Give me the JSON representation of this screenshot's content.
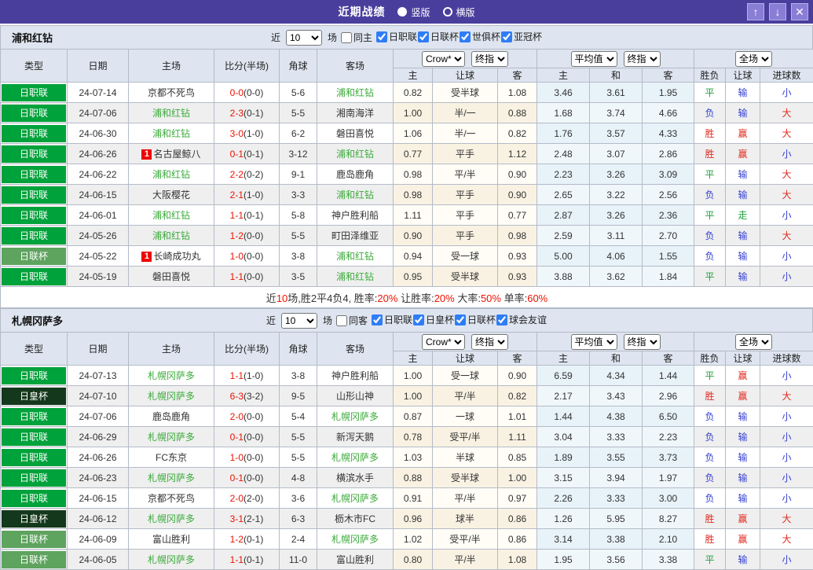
{
  "titlebar": {
    "title": "近期战绩",
    "radios": [
      {
        "label": "竖版",
        "selected": true
      },
      {
        "label": "横版",
        "selected": false
      }
    ],
    "buttons": {
      "up": "↑",
      "down": "↓",
      "close": "✕"
    }
  },
  "colors": {
    "titlebar_bg": "#4a3e9d",
    "button_bg": "#8a7dd5",
    "header_bg": "#dee5f0",
    "league_j1": "#00a23b",
    "league_cup": "#5ea35e",
    "emperor_cup": "#14381b",
    "team_highlight": "#3cab3c",
    "score_red": "#ee1100",
    "win_red": "#e02a1f",
    "draw_green": "#1fa03c",
    "lose_blue": "#3540d0"
  },
  "filter_labels": {
    "near": "近",
    "games": "场"
  },
  "columns": {
    "type": "类型",
    "date": "日期",
    "home": "主场",
    "score": "比分(半场)",
    "corner": "角球",
    "away": "客场",
    "h": "主",
    "handicap": "让球",
    "a": "客",
    "avg_h": "主",
    "avg_d": "和",
    "avg_a": "客",
    "result": "胜负",
    "r_handicap": "让球",
    "goals": "进球数"
  },
  "selects": {
    "crow": "Crow*",
    "final": "终指",
    "average": "平均值",
    "final2": "终指",
    "fulltime": "全场"
  },
  "sections": [
    {
      "team": "浦和红钻",
      "filter": {
        "count": "10",
        "same_label": "同主",
        "same_checked": false,
        "leagues": [
          {
            "label": "日职联",
            "checked": true
          },
          {
            "label": "日联杯",
            "checked": true
          },
          {
            "label": "世俱杯",
            "checked": true
          },
          {
            "label": "亚冠杯",
            "checked": true
          }
        ]
      },
      "rows": [
        {
          "type": "日职联",
          "type_key": "jl",
          "date": "24-07-14",
          "home": "京都不死鸟",
          "home_hl": false,
          "home_rc": false,
          "score": "0-0",
          "half": "(0-0)",
          "corner": "5-6",
          "away": "浦和红钻",
          "away_hl": true,
          "away_rc": false,
          "crow": [
            "0.82",
            "受半球",
            "1.08"
          ],
          "avg": [
            "3.46",
            "3.61",
            "1.95"
          ],
          "results": [
            [
              "平",
              "g"
            ],
            [
              "输",
              "b"
            ],
            [
              "小",
              "b"
            ]
          ]
        },
        {
          "type": "日职联",
          "type_key": "jl",
          "date": "24-07-06",
          "home": "浦和红钻",
          "home_hl": true,
          "home_rc": false,
          "score": "2-3",
          "half": "(0-1)",
          "corner": "5-5",
          "away": "湘南海洋",
          "away_hl": false,
          "away_rc": false,
          "crow": [
            "1.00",
            "半/一",
            "0.88"
          ],
          "avg": [
            "1.68",
            "3.74",
            "4.66"
          ],
          "results": [
            [
              "负",
              "b"
            ],
            [
              "输",
              "b"
            ],
            [
              "大",
              "r"
            ]
          ]
        },
        {
          "type": "日职联",
          "type_key": "jl",
          "date": "24-06-30",
          "home": "浦和红钻",
          "home_hl": true,
          "home_rc": false,
          "score": "3-0",
          "half": "(1-0)",
          "corner": "6-2",
          "away": "磐田喜悦",
          "away_hl": false,
          "away_rc": false,
          "crow": [
            "1.06",
            "半/一",
            "0.82"
          ],
          "avg": [
            "1.76",
            "3.57",
            "4.33"
          ],
          "results": [
            [
              "胜",
              "r"
            ],
            [
              "赢",
              "r"
            ],
            [
              "大",
              "r"
            ]
          ]
        },
        {
          "type": "日职联",
          "type_key": "jl",
          "date": "24-06-26",
          "home": "名古屋鲸八",
          "home_hl": false,
          "home_rc": true,
          "score": "0-1",
          "half": "(0-1)",
          "corner": "3-12",
          "away": "浦和红钻",
          "away_hl": true,
          "away_rc": false,
          "crow": [
            "0.77",
            "平手",
            "1.12"
          ],
          "avg": [
            "2.48",
            "3.07",
            "2.86"
          ],
          "results": [
            [
              "胜",
              "r"
            ],
            [
              "赢",
              "r"
            ],
            [
              "小",
              "b"
            ]
          ]
        },
        {
          "type": "日职联",
          "type_key": "jl",
          "date": "24-06-22",
          "home": "浦和红钻",
          "home_hl": true,
          "home_rc": false,
          "score": "2-2",
          "half": "(0-2)",
          "corner": "9-1",
          "away": "鹿岛鹿角",
          "away_hl": false,
          "away_rc": false,
          "crow": [
            "0.98",
            "平/半",
            "0.90"
          ],
          "avg": [
            "2.23",
            "3.26",
            "3.09"
          ],
          "results": [
            [
              "平",
              "g"
            ],
            [
              "输",
              "b"
            ],
            [
              "大",
              "r"
            ]
          ]
        },
        {
          "type": "日职联",
          "type_key": "jl",
          "date": "24-06-15",
          "home": "大阪樱花",
          "home_hl": false,
          "home_rc": false,
          "score": "2-1",
          "half": "(1-0)",
          "corner": "3-3",
          "away": "浦和红钻",
          "away_hl": true,
          "away_rc": false,
          "crow": [
            "0.98",
            "平手",
            "0.90"
          ],
          "avg": [
            "2.65",
            "3.22",
            "2.56"
          ],
          "results": [
            [
              "负",
              "b"
            ],
            [
              "输",
              "b"
            ],
            [
              "大",
              "r"
            ]
          ]
        },
        {
          "type": "日职联",
          "type_key": "jl",
          "date": "24-06-01",
          "home": "浦和红钻",
          "home_hl": true,
          "home_rc": false,
          "score": "1-1",
          "half": "(0-1)",
          "corner": "5-8",
          "away": "神户胜利船",
          "away_hl": false,
          "away_rc": false,
          "crow": [
            "1.11",
            "平手",
            "0.77"
          ],
          "avg": [
            "2.87",
            "3.26",
            "2.36"
          ],
          "results": [
            [
              "平",
              "g"
            ],
            [
              "走",
              "g"
            ],
            [
              "小",
              "b"
            ]
          ]
        },
        {
          "type": "日职联",
          "type_key": "jl",
          "date": "24-05-26",
          "home": "浦和红钻",
          "home_hl": true,
          "home_rc": false,
          "score": "1-2",
          "half": "(0-0)",
          "corner": "5-5",
          "away": "町田泽维亚",
          "away_hl": false,
          "away_rc": false,
          "crow": [
            "0.90",
            "平手",
            "0.98"
          ],
          "avg": [
            "2.59",
            "3.11",
            "2.70"
          ],
          "results": [
            [
              "负",
              "b"
            ],
            [
              "输",
              "b"
            ],
            [
              "大",
              "r"
            ]
          ]
        },
        {
          "type": "日联杯",
          "type_key": "lc",
          "date": "24-05-22",
          "home": "长崎成功丸",
          "home_hl": false,
          "home_rc": true,
          "score": "1-0",
          "half": "(0-0)",
          "corner": "3-8",
          "away": "浦和红钻",
          "away_hl": true,
          "away_rc": false,
          "crow": [
            "0.94",
            "受一球",
            "0.93"
          ],
          "avg": [
            "5.00",
            "4.06",
            "1.55"
          ],
          "results": [
            [
              "负",
              "b"
            ],
            [
              "输",
              "b"
            ],
            [
              "小",
              "b"
            ]
          ]
        },
        {
          "type": "日职联",
          "type_key": "jl",
          "date": "24-05-19",
          "home": "磐田喜悦",
          "home_hl": false,
          "home_rc": false,
          "score": "1-1",
          "half": "(0-0)",
          "corner": "3-5",
          "away": "浦和红钻",
          "away_hl": true,
          "away_rc": false,
          "crow": [
            "0.95",
            "受半球",
            "0.93"
          ],
          "avg": [
            "3.88",
            "3.62",
            "1.84"
          ],
          "results": [
            [
              "平",
              "g"
            ],
            [
              "输",
              "b"
            ],
            [
              "小",
              "b"
            ]
          ]
        }
      ],
      "summary": [
        [
          "近",
          "k"
        ],
        [
          "10",
          "r"
        ],
        [
          "场,胜2平4负4, 胜率:",
          "k"
        ],
        [
          "20%",
          "r"
        ],
        [
          " 让胜率:",
          "k"
        ],
        [
          "20%",
          "r"
        ],
        [
          " 大率:",
          "k"
        ],
        [
          "50%",
          "r"
        ],
        [
          " 单率:",
          "k"
        ],
        [
          "60%",
          "r"
        ]
      ]
    },
    {
      "team": "札幌冈萨多",
      "filter": {
        "count": "10",
        "same_label": "同客",
        "same_checked": false,
        "leagues": [
          {
            "label": "日职联",
            "checked": true
          },
          {
            "label": "日皇杯",
            "checked": true
          },
          {
            "label": "日联杯",
            "checked": true
          },
          {
            "label": "球会友谊",
            "checked": true
          }
        ]
      },
      "rows": [
        {
          "type": "日职联",
          "type_key": "jl",
          "date": "24-07-13",
          "home": "札幌冈萨多",
          "home_hl": true,
          "home_rc": false,
          "score": "1-1",
          "half": "(1-0)",
          "corner": "3-8",
          "away": "神户胜利船",
          "away_hl": false,
          "away_rc": false,
          "crow": [
            "1.00",
            "受一球",
            "0.90"
          ],
          "avg": [
            "6.59",
            "4.34",
            "1.44"
          ],
          "results": [
            [
              "平",
              "g"
            ],
            [
              "赢",
              "r"
            ],
            [
              "小",
              "b"
            ]
          ]
        },
        {
          "type": "日皇杯",
          "type_key": "ec",
          "date": "24-07-10",
          "home": "札幌冈萨多",
          "home_hl": true,
          "home_rc": false,
          "score": "6-3",
          "half": "(3-2)",
          "corner": "9-5",
          "away": "山形山神",
          "away_hl": false,
          "away_rc": false,
          "crow": [
            "1.00",
            "平/半",
            "0.82"
          ],
          "avg": [
            "2.17",
            "3.43",
            "2.96"
          ],
          "results": [
            [
              "胜",
              "r"
            ],
            [
              "赢",
              "r"
            ],
            [
              "大",
              "r"
            ]
          ]
        },
        {
          "type": "日职联",
          "type_key": "jl",
          "date": "24-07-06",
          "home": "鹿岛鹿角",
          "home_hl": false,
          "home_rc": false,
          "score": "2-0",
          "half": "(0-0)",
          "corner": "5-4",
          "away": "札幌冈萨多",
          "away_hl": true,
          "away_rc": false,
          "crow": [
            "0.87",
            "一球",
            "1.01"
          ],
          "avg": [
            "1.44",
            "4.38",
            "6.50"
          ],
          "results": [
            [
              "负",
              "b"
            ],
            [
              "输",
              "b"
            ],
            [
              "小",
              "b"
            ]
          ]
        },
        {
          "type": "日职联",
          "type_key": "jl",
          "date": "24-06-29",
          "home": "札幌冈萨多",
          "home_hl": true,
          "home_rc": false,
          "score": "0-1",
          "half": "(0-0)",
          "corner": "5-5",
          "away": "新泻天鹅",
          "away_hl": false,
          "away_rc": false,
          "crow": [
            "0.78",
            "受平/半",
            "1.11"
          ],
          "avg": [
            "3.04",
            "3.33",
            "2.23"
          ],
          "results": [
            [
              "负",
              "b"
            ],
            [
              "输",
              "b"
            ],
            [
              "小",
              "b"
            ]
          ]
        },
        {
          "type": "日职联",
          "type_key": "jl",
          "date": "24-06-26",
          "home": "FC东京",
          "home_hl": false,
          "home_rc": false,
          "score": "1-0",
          "half": "(0-0)",
          "corner": "5-5",
          "away": "札幌冈萨多",
          "away_hl": true,
          "away_rc": false,
          "crow": [
            "1.03",
            "半球",
            "0.85"
          ],
          "avg": [
            "1.89",
            "3.55",
            "3.73"
          ],
          "results": [
            [
              "负",
              "b"
            ],
            [
              "输",
              "b"
            ],
            [
              "小",
              "b"
            ]
          ]
        },
        {
          "type": "日职联",
          "type_key": "jl",
          "date": "24-06-23",
          "home": "札幌冈萨多",
          "home_hl": true,
          "home_rc": false,
          "score": "0-1",
          "half": "(0-0)",
          "corner": "4-8",
          "away": "横滨水手",
          "away_hl": false,
          "away_rc": false,
          "crow": [
            "0.88",
            "受半球",
            "1.00"
          ],
          "avg": [
            "3.15",
            "3.94",
            "1.97"
          ],
          "results": [
            [
              "负",
              "b"
            ],
            [
              "输",
              "b"
            ],
            [
              "小",
              "b"
            ]
          ]
        },
        {
          "type": "日职联",
          "type_key": "jl",
          "date": "24-06-15",
          "home": "京都不死鸟",
          "home_hl": false,
          "home_rc": false,
          "score": "2-0",
          "half": "(2-0)",
          "corner": "3-6",
          "away": "札幌冈萨多",
          "away_hl": true,
          "away_rc": false,
          "crow": [
            "0.91",
            "平/半",
            "0.97"
          ],
          "avg": [
            "2.26",
            "3.33",
            "3.00"
          ],
          "results": [
            [
              "负",
              "b"
            ],
            [
              "输",
              "b"
            ],
            [
              "小",
              "b"
            ]
          ]
        },
        {
          "type": "日皇杯",
          "type_key": "ec",
          "date": "24-06-12",
          "home": "札幌冈萨多",
          "home_hl": true,
          "home_rc": false,
          "score": "3-1",
          "half": "(2-1)",
          "corner": "6-3",
          "away": "枥木市FC",
          "away_hl": false,
          "away_rc": false,
          "crow": [
            "0.96",
            "球半",
            "0.86"
          ],
          "avg": [
            "1.26",
            "5.95",
            "8.27"
          ],
          "results": [
            [
              "胜",
              "r"
            ],
            [
              "赢",
              "r"
            ],
            [
              "大",
              "r"
            ]
          ]
        },
        {
          "type": "日联杯",
          "type_key": "lc",
          "date": "24-06-09",
          "home": "富山胜利",
          "home_hl": false,
          "home_rc": false,
          "score": "1-2",
          "half": "(0-1)",
          "corner": "2-4",
          "away": "札幌冈萨多",
          "away_hl": true,
          "away_rc": false,
          "crow": [
            "1.02",
            "受平/半",
            "0.86"
          ],
          "avg": [
            "3.14",
            "3.38",
            "2.10"
          ],
          "results": [
            [
              "胜",
              "r"
            ],
            [
              "赢",
              "r"
            ],
            [
              "大",
              "r"
            ]
          ]
        },
        {
          "type": "日联杯",
          "type_key": "lc",
          "date": "24-06-05",
          "home": "札幌冈萨多",
          "home_hl": true,
          "home_rc": false,
          "score": "1-1",
          "half": "(0-1)",
          "corner": "11-0",
          "away": "富山胜利",
          "away_hl": false,
          "away_rc": false,
          "crow": [
            "0.80",
            "平/半",
            "1.08"
          ],
          "avg": [
            "1.95",
            "3.56",
            "3.38"
          ],
          "results": [
            [
              "平",
              "g"
            ],
            [
              "输",
              "b"
            ],
            [
              "小",
              "b"
            ]
          ]
        }
      ],
      "summary": null
    }
  ]
}
